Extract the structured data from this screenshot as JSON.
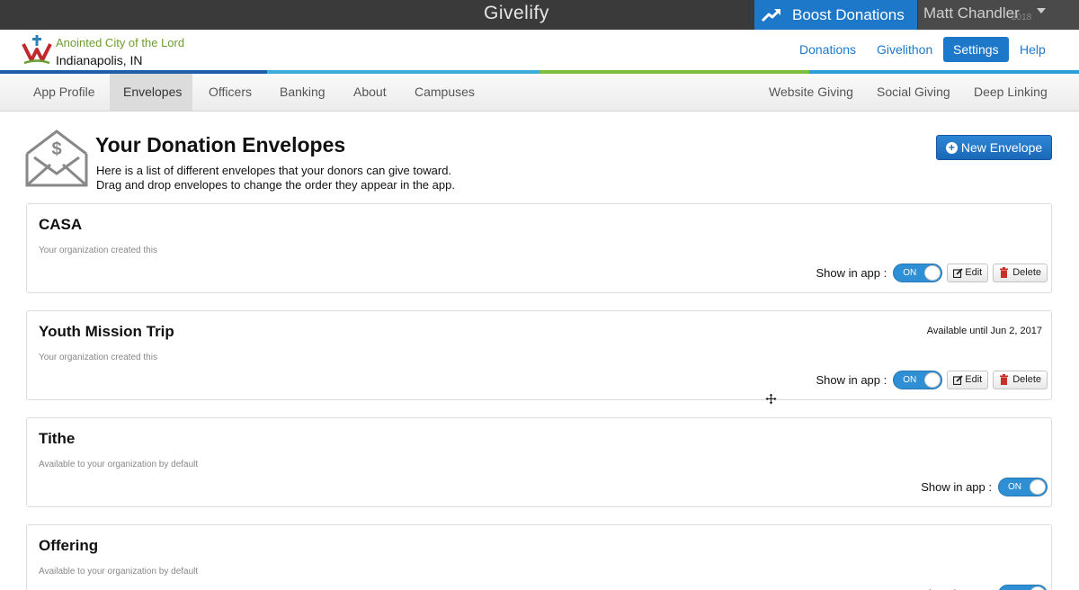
{
  "topbar": {
    "brand": "Givelify",
    "boost_label": "Boost Donations",
    "user_name": "Matt Chandler",
    "user_sub": "2018"
  },
  "org": {
    "name": "Anointed City of the Lord",
    "city": "Indianapolis, IN"
  },
  "nav": {
    "donations": "Donations",
    "givelithon": "Givelithon",
    "settings": "Settings",
    "help": "Help"
  },
  "tabs": {
    "app_profile": "App Profile",
    "envelopes": "Envelopes",
    "officers": "Officers",
    "banking": "Banking",
    "about": "About",
    "campuses": "Campuses",
    "website_giving": "Website Giving",
    "social_giving": "Social Giving",
    "deep_linking": "Deep Linking"
  },
  "page": {
    "title": "Your Donation Envelopes",
    "desc_line1": "Here is a list of different envelopes that your donors can give toward.",
    "desc_line2": "Drag and drop envelopes to change the order they appear in the app.",
    "new_button": "New Envelope"
  },
  "labels": {
    "show_in_app": "Show in app :",
    "toggle_on": "ON",
    "edit": "Edit",
    "delete": "Delete"
  },
  "envelopes": [
    {
      "name": "CASA",
      "note": "Your organization created this",
      "available": ""
    },
    {
      "name": "Youth Mission Trip",
      "note": "Your organization created this",
      "available": "Available until Jun 2, 2017"
    },
    {
      "name": "Tithe",
      "note": "Available to your organization by default",
      "available": ""
    },
    {
      "name": "Offering",
      "note": "Available to your organization by default",
      "available": ""
    }
  ],
  "colors": {
    "primary": "#1d78c9",
    "org_green": "#6a9e2e",
    "stripe": [
      "#1d5fa8",
      "#3aaed8",
      "#7cbf3f",
      "#2a9fd8"
    ]
  }
}
